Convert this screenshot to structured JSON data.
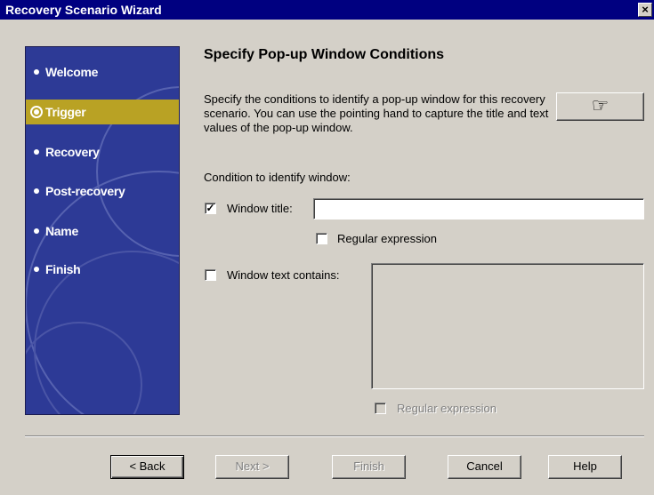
{
  "window": {
    "title": "Recovery Scenario Wizard",
    "close_glyph": "×"
  },
  "sidebar": {
    "items": [
      {
        "label": "Welcome",
        "active": false
      },
      {
        "label": "Trigger",
        "active": true
      },
      {
        "label": "Recovery",
        "active": false
      },
      {
        "label": "Post-recovery",
        "active": false
      },
      {
        "label": "Name",
        "active": false
      },
      {
        "label": "Finish",
        "active": false
      }
    ]
  },
  "main": {
    "heading": "Specify Pop-up Window Conditions",
    "description": "Specify the conditions to identify a pop-up window for this recovery scenario. You can use the pointing hand to capture the title and text values of the pop-up window.",
    "pointer_glyph": "☞",
    "condition_label": "Condition to identify window:",
    "window_title": {
      "label": "Window title:",
      "checked": true,
      "value": ""
    },
    "title_regex": {
      "label": "Regular expression",
      "checked": false
    },
    "window_text": {
      "label": "Window text contains:",
      "checked": false,
      "value": ""
    },
    "text_regex": {
      "label": "Regular expression",
      "checked": false,
      "enabled": false
    }
  },
  "footer": {
    "back": "< Back",
    "next": "Next >",
    "finish": "Finish",
    "cancel": "Cancel",
    "help": "Help"
  }
}
